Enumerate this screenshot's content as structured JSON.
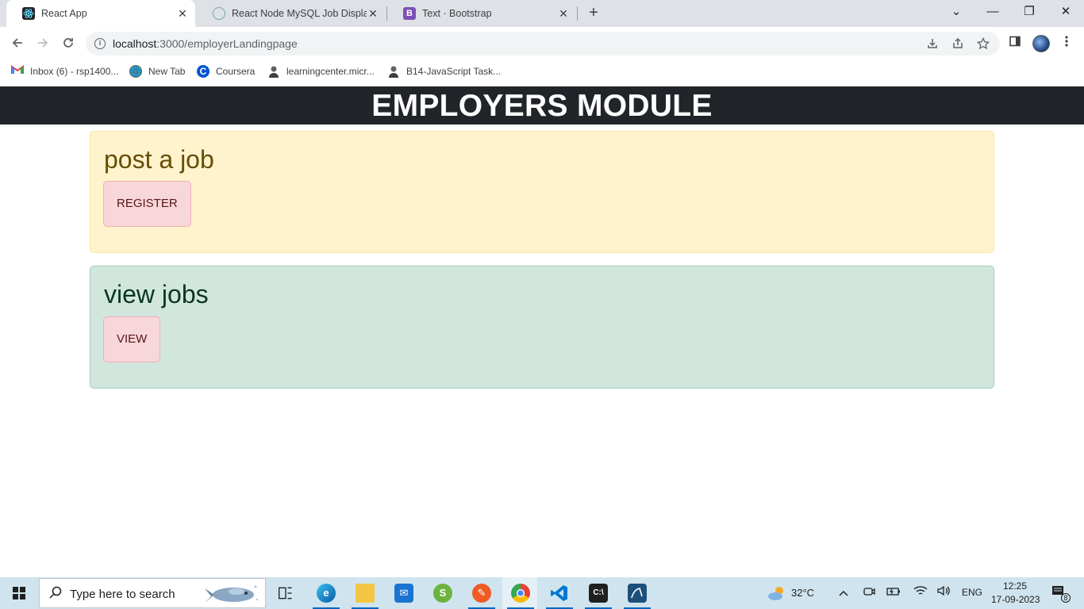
{
  "browser": {
    "tabs": [
      {
        "title": "React App",
        "active": true,
        "favicon": "react-icon"
      },
      {
        "title": "React Node MySQL Job Display",
        "active": false,
        "favicon": "chatgpt-icon"
      },
      {
        "title": "Text · Bootstrap",
        "active": false,
        "favicon": "bootstrap-icon"
      }
    ],
    "close_glyph": "✕",
    "new_tab_glyph": "+",
    "window_controls": {
      "minimize": "—",
      "restore": "❐",
      "close": "✕",
      "tab_search": "⌄"
    },
    "address": {
      "host": "localhost",
      "path": ":3000/employerLandingpage"
    },
    "bookmarks": [
      {
        "label": "Inbox (6) - rsp1400...",
        "icon": "gmail-icon"
      },
      {
        "label": "New Tab",
        "icon": "globe-icon"
      },
      {
        "label": "Coursera",
        "icon": "coursera-icon"
      },
      {
        "label": "learningcenter.micr...",
        "icon": "person-icon"
      },
      {
        "label": "B14-JavaScript Task...",
        "icon": "person-icon"
      }
    ]
  },
  "page": {
    "header": "EMPLOYERS MODULE",
    "post_card": {
      "title": "post a job",
      "button": "REGISTER"
    },
    "view_card": {
      "title": "view jobs",
      "button": "VIEW"
    },
    "colors": {
      "header_bg": "#212529",
      "warning_bg": "#fff3cd",
      "success_bg": "#d1e7dd",
      "danger_btn_bg": "#f8d7da"
    }
  },
  "taskbar": {
    "search_placeholder": "Type here to search",
    "weather": "32°C",
    "language": "ENG",
    "time": "12:25",
    "date": "17-09-2023",
    "notification_count": "8"
  }
}
